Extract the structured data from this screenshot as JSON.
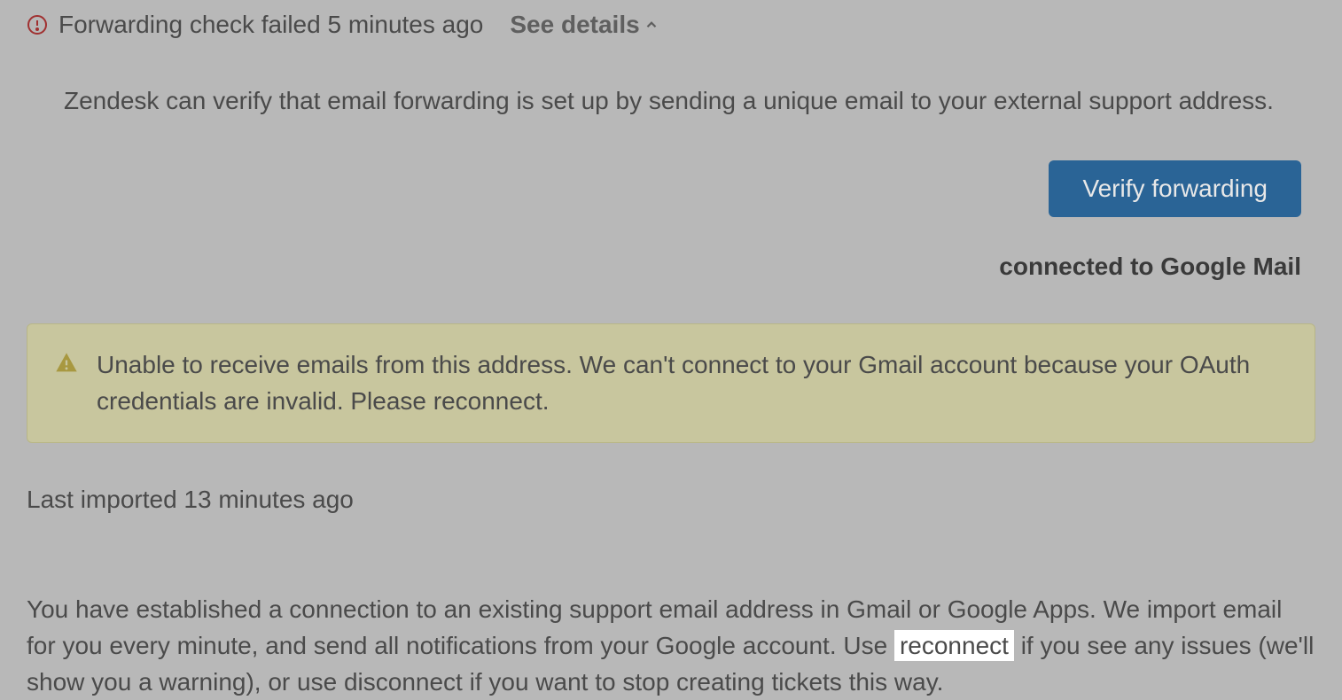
{
  "status": {
    "text": "Forwarding check failed 5 minutes ago",
    "see_details": "See details"
  },
  "verify": {
    "description": "Zendesk can verify that email forwarding is set up by sending a unique email to your external support address.",
    "button_label": "Verify forwarding"
  },
  "connection": {
    "status": "connected to Google Mail"
  },
  "warning": {
    "message": "Unable to receive emails from this address. We can't connect to your Gmail account because your OAuth credentials are invalid. Please reconnect."
  },
  "import": {
    "last": "Last imported 13 minutes ago"
  },
  "info": {
    "text_before": "You have established a connection to an existing support email address in Gmail or Google Apps. We import email for you every minute, and send all notifications from your Google account. Use ",
    "reconnect": "reconnect",
    "text_after": " if you see any issues (we'll show you a warning), or use disconnect if you want to stop creating tickets this way."
  }
}
